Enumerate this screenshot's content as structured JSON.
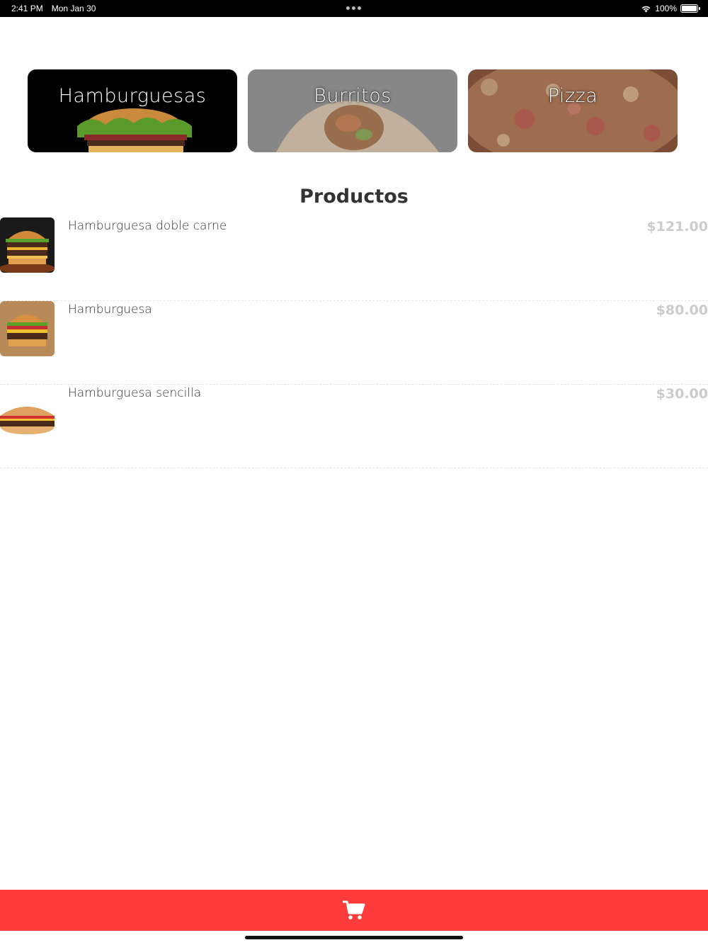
{
  "status_bar": {
    "time": "2:41 PM",
    "date": "Mon Jan 30",
    "battery": "100%"
  },
  "categories": [
    {
      "label": "Hamburguesas",
      "icon": "hamburger-image"
    },
    {
      "label": "Burritos",
      "icon": "burrito-image"
    },
    {
      "label": "Pizza",
      "icon": "pizza-image"
    }
  ],
  "section_title": "Productos",
  "products": [
    {
      "name": "Hamburguesa doble carne",
      "price": "$121.00",
      "icon": "double-burger-image"
    },
    {
      "name": "Hamburguesa",
      "price": "$80.00",
      "icon": "burger-image"
    },
    {
      "name": "Hamburguesa sencilla",
      "price": "$30.00",
      "icon": "simple-burger-image"
    }
  ],
  "cart": {
    "icon": "shopping-cart-icon"
  },
  "colors": {
    "accent": "#ff3b3b",
    "price_text": "#cccccc",
    "title_text": "#333333"
  }
}
